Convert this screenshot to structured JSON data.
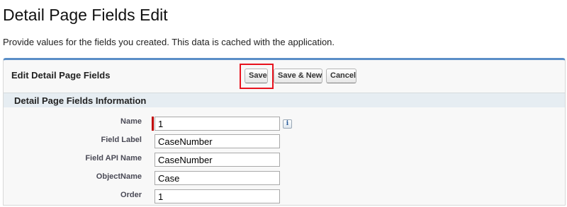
{
  "page": {
    "title": "Detail Page Fields Edit",
    "description": "Provide values for the fields you created. This data is cached with the application."
  },
  "panel": {
    "title": "Edit Detail Page Fields",
    "buttons": {
      "save": "Save",
      "save_new": "Save & New",
      "cancel": "Cancel"
    },
    "highlight_color": "#e8121d"
  },
  "section": {
    "title": "Detail Page Fields Information"
  },
  "fields": {
    "name": {
      "label": "Name",
      "value": "1",
      "required": true,
      "info_icon": "info-icon"
    },
    "field_label": {
      "label": "Field Label",
      "value": "CaseNumber"
    },
    "field_api_name": {
      "label": "Field API Name",
      "value": "CaseNumber"
    },
    "object_name": {
      "label": "ObjectName",
      "value": "Case"
    },
    "order": {
      "label": "Order",
      "value": "1"
    }
  },
  "icons": {
    "info_glyph": "i"
  }
}
